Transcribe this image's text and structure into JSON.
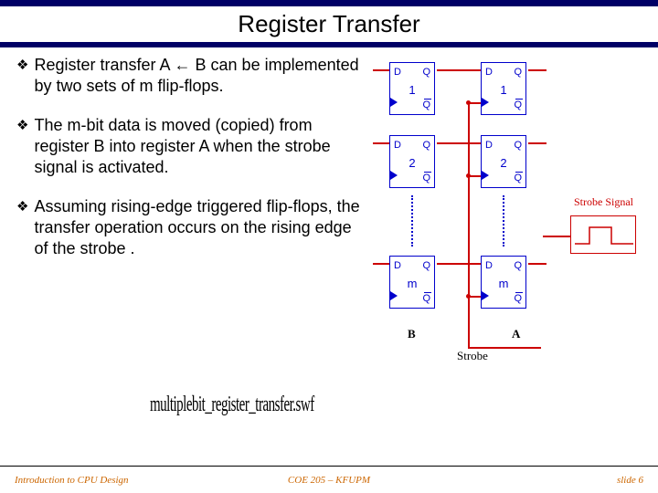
{
  "title": "Register Transfer",
  "bullets": [
    "Register transfer A ← B can be implemented by two sets of m flip-flops.",
    "The m-bit data is moved (copied) from register B into register A when the strobe signal is activated.",
    "Assuming rising-edge triggered flip-flops, the transfer operation occurs on the rising edge of the strobe ."
  ],
  "diagram": {
    "ff_d": "D",
    "ff_q": "Q",
    "ff_qbar": "Q",
    "nums": [
      "1",
      "2",
      "m"
    ],
    "label_b": "B",
    "label_a": "A",
    "label_strobe": "Strobe",
    "strobe_signal": "Strobe Signal"
  },
  "swf": "multiplebit_register_transfer.swf",
  "footer": {
    "left": "Introduction to CPU Design",
    "center": "COE 205 – KFUPM",
    "right": "slide 6"
  }
}
